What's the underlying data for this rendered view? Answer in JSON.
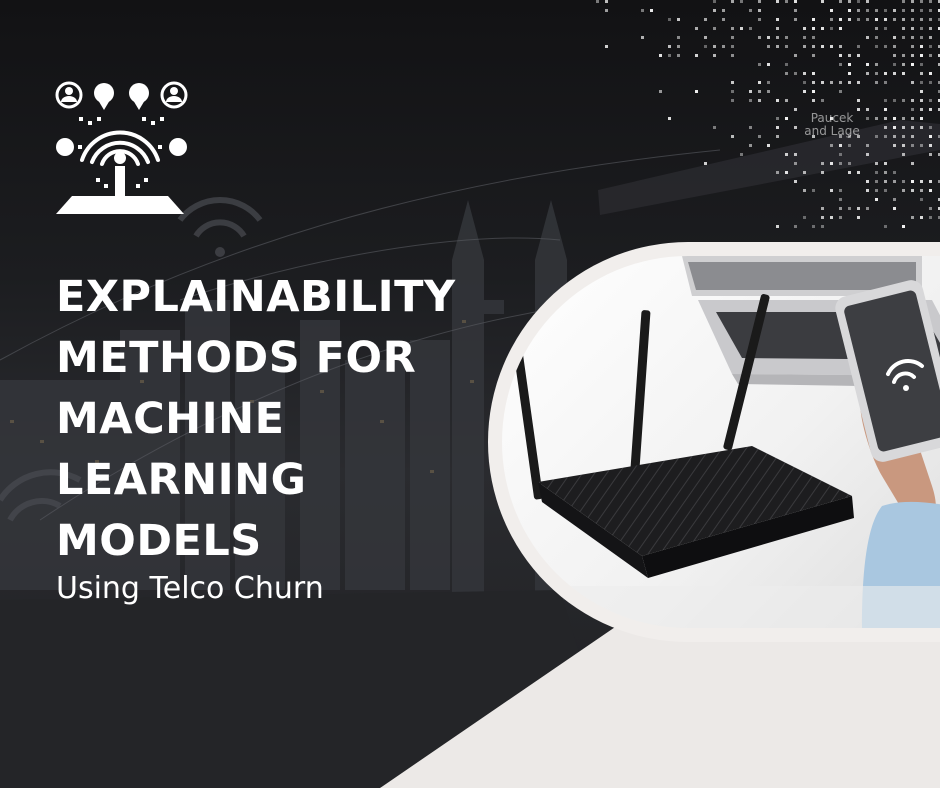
{
  "headline": {
    "lines": [
      "EXPLAINABILITY",
      "METHODS FOR",
      "MACHINE",
      "LEARNING",
      "MODELS"
    ]
  },
  "subtitle": "Using Telco Churn",
  "brand": {
    "line1": "Paucek",
    "line2": "and Lage"
  },
  "icons": {
    "logo": "network-users-wifi-icon",
    "phone_wifi": "wifi-icon"
  },
  "colors": {
    "background_dark": "#1c1d20",
    "text": "#ffffff",
    "frame": "#f1eeec",
    "router": "#1a1a1a"
  }
}
